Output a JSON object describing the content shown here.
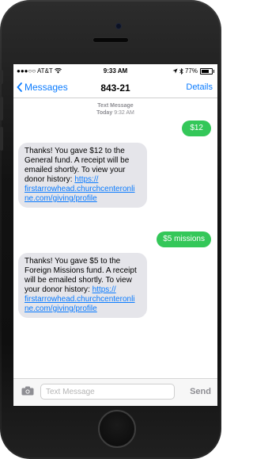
{
  "status_bar": {
    "carrier": "●●●○○ AT&T",
    "time": "9:33 AM",
    "battery": "77%",
    "battery_fraction": 0.77
  },
  "nav": {
    "back_label": "Messages",
    "title": "843-21",
    "details_label": "Details"
  },
  "thread": {
    "meta_label": "Text Message",
    "meta_time_day": "Today",
    "meta_time": "9:32 AM",
    "messages": [
      {
        "from": "me",
        "text": "$12"
      },
      {
        "from": "them",
        "text": "Thanks! You gave $12 to the General fund. A receipt will be emailed shortly. To view your donor history: ",
        "link": "https://firstarrowhead.churchcenteronline.com/giving/profile",
        "link_display": "https://\nfirstarrowhead.churchcenteronli\nne.com/giving/profile"
      },
      {
        "from": "me",
        "text": "$5 missions"
      },
      {
        "from": "them",
        "text": "Thanks! You gave $5 to the Foreign Missions fund. A receipt will be emailed shortly. To view your donor history: ",
        "link": "https://firstarrowhead.churchcenteronline.com/giving/profile",
        "link_display": "https://\nfirstarrowhead.churchcenteronli\nne.com/giving/profile"
      }
    ]
  },
  "composer": {
    "placeholder": "Text Message",
    "send_label": "Send"
  },
  "colors": {
    "ios_blue": "#0a7bff",
    "sent_green": "#34c759",
    "received_gray": "#e5e5ea"
  },
  "icons": [
    "chevron-left-icon",
    "wifi-icon",
    "location-arrow-icon",
    "bluetooth-icon",
    "battery-icon",
    "camera-icon"
  ]
}
